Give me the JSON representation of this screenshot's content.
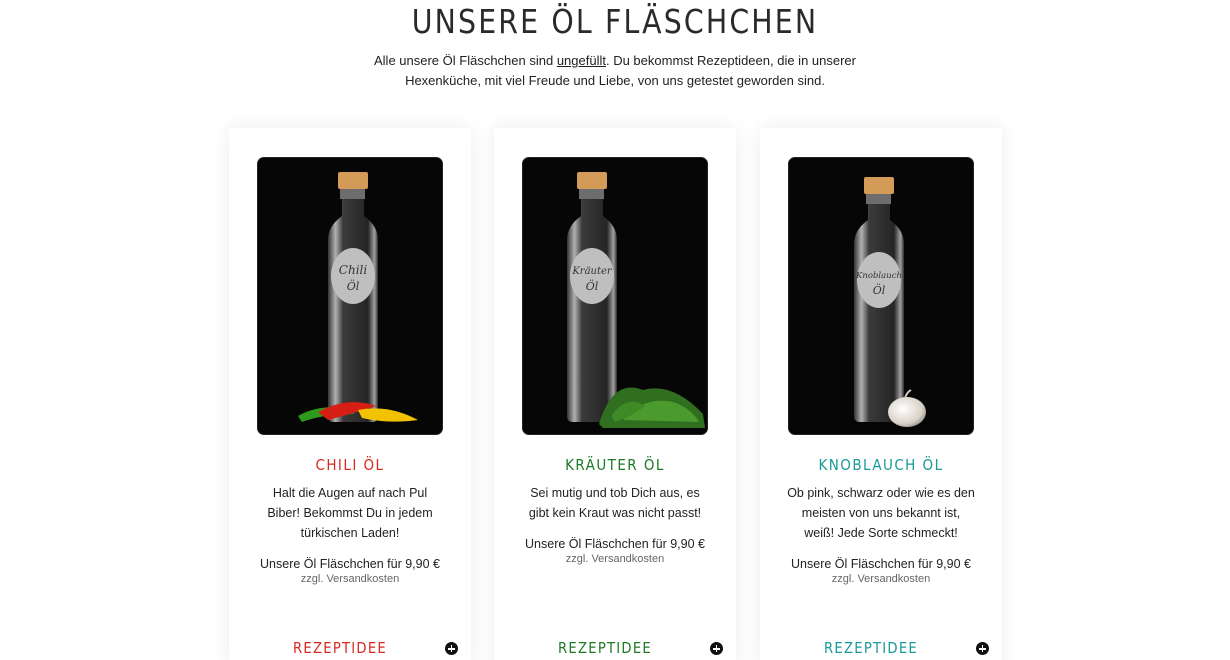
{
  "header": {
    "title": "UNSERE ÖL FLÄSCHCHEN",
    "intro_before": "Alle unsere Öl Fläschchen sind ",
    "intro_link": "ungefüllt",
    "intro_after_line1": ". Du bekommst Rezeptideen, die in unserer",
    "intro_line2": "Hexenküche, mit viel Freude und Liebe, von uns getestet geworden sind."
  },
  "colors": {
    "chili": "#d92a1f",
    "kraeuter": "#1f7a28",
    "knoblauch": "#1a9a96"
  },
  "products": [
    {
      "name": "CHILI ÖL",
      "bottle_label_1": "Chili",
      "bottle_label_2": "Öl",
      "desc_1": "Halt die Augen auf nach Pul",
      "desc_2": "Biber! Bekommst Du in jedem",
      "desc_3": "türkischen Laden!",
      "price": "Unsere Öl Fläschchen für 9,90 €",
      "shipping": "zzgl. Versandkosten",
      "recipe": "REZEPTIDEE",
      "image_icon": "chili-bottle-image"
    },
    {
      "name": "KRÄUTER ÖL",
      "bottle_label_1": "Kräuter",
      "bottle_label_2": "Öl",
      "desc_1": "Sei mutig und tob Dich aus, es",
      "desc_2": "gibt kein Kraut was nicht passt!",
      "price": "Unsere Öl Fläschchen für 9,90 €",
      "shipping": "zzgl. Versandkosten",
      "recipe": "REZEPTIDEE",
      "image_icon": "herb-bottle-image"
    },
    {
      "name": "KNOBLAUCH ÖL",
      "bottle_label_1": "Knoblauch",
      "bottle_label_2": "Öl",
      "desc_1": "Ob pink, schwarz oder wie es den",
      "desc_2": "meisten von uns bekannt ist,",
      "desc_3": "weiß! Jede Sorte schmeckt!",
      "price": "Unsere Öl Fläschchen für 9,90 €",
      "shipping": "zzgl. Versandkosten",
      "recipe": "REZEPTIDEE",
      "image_icon": "garlic-bottle-image"
    }
  ]
}
